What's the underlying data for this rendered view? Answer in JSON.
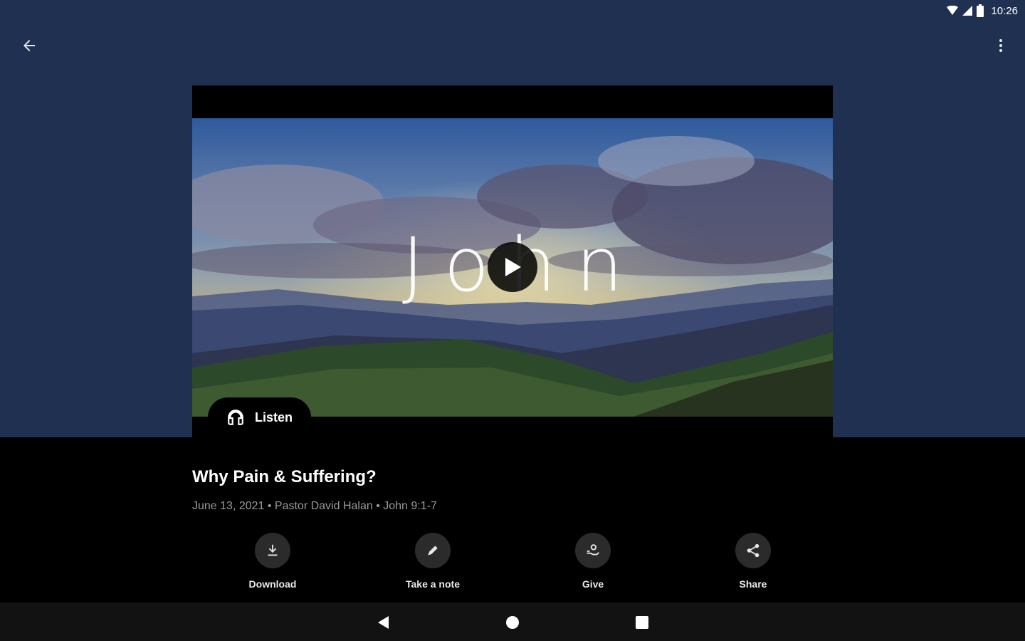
{
  "status_bar": {
    "time": "10:26",
    "icons": [
      "wifi-icon",
      "signal-icon",
      "battery-icon"
    ]
  },
  "app_bar": {
    "back_icon": "arrow-left-icon",
    "menu_icon": "more-vert-icon"
  },
  "video": {
    "title_art": "John",
    "play_icon": "play-icon"
  },
  "listen": {
    "label": "Listen",
    "icon": "headphones-icon"
  },
  "sermon": {
    "title": "Why Pain & Suffering?",
    "meta": "June 13, 2021 • Pastor David Halan • John 9:1-7"
  },
  "actions": [
    {
      "label": "Download",
      "icon": "download-icon"
    },
    {
      "label": "Take a note",
      "icon": "pencil-icon"
    },
    {
      "label": "Give",
      "icon": "give-icon"
    },
    {
      "label": "Share",
      "icon": "share-icon"
    }
  ],
  "nav": {
    "back": "nav-back-icon",
    "home": "nav-home-icon",
    "recents": "nav-recents-icon"
  },
  "colors": {
    "header_bg": "#1f3050",
    "body_bg": "#000000",
    "action_circle": "#2b2b2b",
    "meta_text": "#9a9a9a",
    "nav_bg": "#121212"
  }
}
